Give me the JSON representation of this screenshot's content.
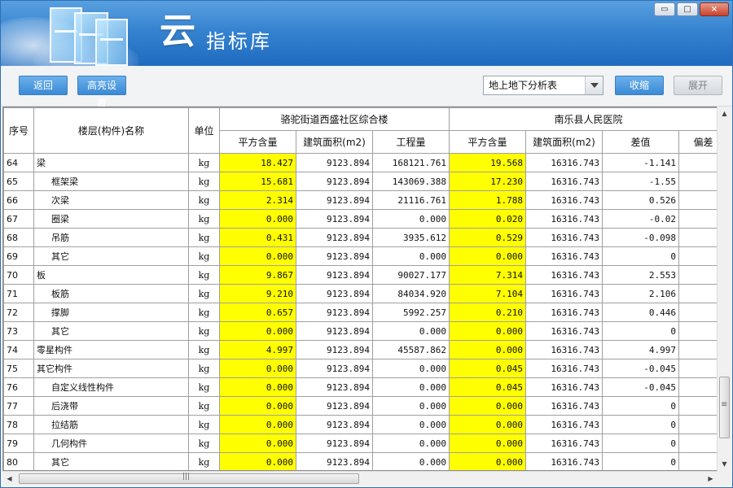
{
  "window": {
    "title_glyph": "云",
    "title": "指标库",
    "controls": {
      "minimize": "▭",
      "restore": "□",
      "close": "×"
    }
  },
  "toolbar": {
    "back_label": "返回",
    "highlight_label": "高亮设置",
    "report_select_value": "地上地下分析表",
    "collapse_label": "收缩",
    "expand_label": "展开"
  },
  "table": {
    "headers": {
      "index": "序号",
      "name": "楼层(构件)名称",
      "unit": "单位",
      "project1": "骆驼街道西盛社区综合楼",
      "project2": "南乐县人民医院",
      "p1_cols": [
        "平方含量",
        "建筑面积(m2)",
        "工程量"
      ],
      "p2_cols": [
        "平方含量",
        "建筑面积(m2)",
        "差值",
        "偏差"
      ]
    },
    "rows": [
      {
        "idx": "64",
        "name": "梁",
        "indent": false,
        "unit": "kg",
        "p1_ratio": "18.427",
        "p1_area": "9123.894",
        "p1_qty": "168121.761",
        "p2_ratio": "19.568",
        "p2_area": "16316.743",
        "diff": "-1.141"
      },
      {
        "idx": "65",
        "name": "框架梁",
        "indent": true,
        "unit": "kg",
        "p1_ratio": "15.681",
        "p1_area": "9123.894",
        "p1_qty": "143069.388",
        "p2_ratio": "17.230",
        "p2_area": "16316.743",
        "diff": "-1.55"
      },
      {
        "idx": "66",
        "name": "次梁",
        "indent": true,
        "unit": "kg",
        "p1_ratio": "2.314",
        "p1_area": "9123.894",
        "p1_qty": "21116.761",
        "p2_ratio": "1.788",
        "p2_area": "16316.743",
        "diff": "0.526"
      },
      {
        "idx": "67",
        "name": "圈梁",
        "indent": true,
        "unit": "kg",
        "p1_ratio": "0.000",
        "p1_area": "9123.894",
        "p1_qty": "0.000",
        "p2_ratio": "0.020",
        "p2_area": "16316.743",
        "diff": "-0.02"
      },
      {
        "idx": "68",
        "name": "吊筋",
        "indent": true,
        "unit": "kg",
        "p1_ratio": "0.431",
        "p1_area": "9123.894",
        "p1_qty": "3935.612",
        "p2_ratio": "0.529",
        "p2_area": "16316.743",
        "diff": "-0.098"
      },
      {
        "idx": "69",
        "name": "其它",
        "indent": true,
        "unit": "kg",
        "p1_ratio": "0.000",
        "p1_area": "9123.894",
        "p1_qty": "0.000",
        "p2_ratio": "0.000",
        "p2_area": "16316.743",
        "diff": "0"
      },
      {
        "idx": "70",
        "name": "板",
        "indent": false,
        "unit": "kg",
        "p1_ratio": "9.867",
        "p1_area": "9123.894",
        "p1_qty": "90027.177",
        "p2_ratio": "7.314",
        "p2_area": "16316.743",
        "diff": "2.553"
      },
      {
        "idx": "71",
        "name": "板筋",
        "indent": true,
        "unit": "kg",
        "p1_ratio": "9.210",
        "p1_area": "9123.894",
        "p1_qty": "84034.920",
        "p2_ratio": "7.104",
        "p2_area": "16316.743",
        "diff": "2.106"
      },
      {
        "idx": "72",
        "name": "撑脚",
        "indent": true,
        "unit": "kg",
        "p1_ratio": "0.657",
        "p1_area": "9123.894",
        "p1_qty": "5992.257",
        "p2_ratio": "0.210",
        "p2_area": "16316.743",
        "diff": "0.446"
      },
      {
        "idx": "73",
        "name": "其它",
        "indent": true,
        "unit": "kg",
        "p1_ratio": "0.000",
        "p1_area": "9123.894",
        "p1_qty": "0.000",
        "p2_ratio": "0.000",
        "p2_area": "16316.743",
        "diff": "0"
      },
      {
        "idx": "74",
        "name": "零星构件",
        "indent": false,
        "unit": "kg",
        "p1_ratio": "4.997",
        "p1_area": "9123.894",
        "p1_qty": "45587.862",
        "p2_ratio": "0.000",
        "p2_area": "16316.743",
        "diff": "4.997"
      },
      {
        "idx": "75",
        "name": "其它构件",
        "indent": false,
        "unit": "kg",
        "p1_ratio": "0.000",
        "p1_area": "9123.894",
        "p1_qty": "0.000",
        "p2_ratio": "0.045",
        "p2_area": "16316.743",
        "diff": "-0.045"
      },
      {
        "idx": "76",
        "name": "自定义线性构件",
        "indent": true,
        "unit": "kg",
        "p1_ratio": "0.000",
        "p1_area": "9123.894",
        "p1_qty": "0.000",
        "p2_ratio": "0.045",
        "p2_area": "16316.743",
        "diff": "-0.045"
      },
      {
        "idx": "77",
        "name": "后浇带",
        "indent": true,
        "unit": "kg",
        "p1_ratio": "0.000",
        "p1_area": "9123.894",
        "p1_qty": "0.000",
        "p2_ratio": "0.000",
        "p2_area": "16316.743",
        "diff": "0"
      },
      {
        "idx": "78",
        "name": "拉结筋",
        "indent": true,
        "unit": "kg",
        "p1_ratio": "0.000",
        "p1_area": "9123.894",
        "p1_qty": "0.000",
        "p2_ratio": "0.000",
        "p2_area": "16316.743",
        "diff": "0"
      },
      {
        "idx": "79",
        "name": "几何构件",
        "indent": true,
        "unit": "kg",
        "p1_ratio": "0.000",
        "p1_area": "9123.894",
        "p1_qty": "0.000",
        "p2_ratio": "0.000",
        "p2_area": "16316.743",
        "diff": "0"
      },
      {
        "idx": "80",
        "name": "其它",
        "indent": true,
        "unit": "kg",
        "p1_ratio": "0.000",
        "p1_area": "9123.894",
        "p1_qty": "0.000",
        "p2_ratio": "0.000",
        "p2_area": "16316.743",
        "diff": "0"
      }
    ]
  },
  "colors": {
    "highlight": "#ffff00",
    "accent_button": "#3a8ad6",
    "banner": "#3583d0"
  },
  "icons": {
    "scroll_up": "▲",
    "scroll_down": "▼",
    "scroll_left": "◀",
    "scroll_right": "▶"
  }
}
